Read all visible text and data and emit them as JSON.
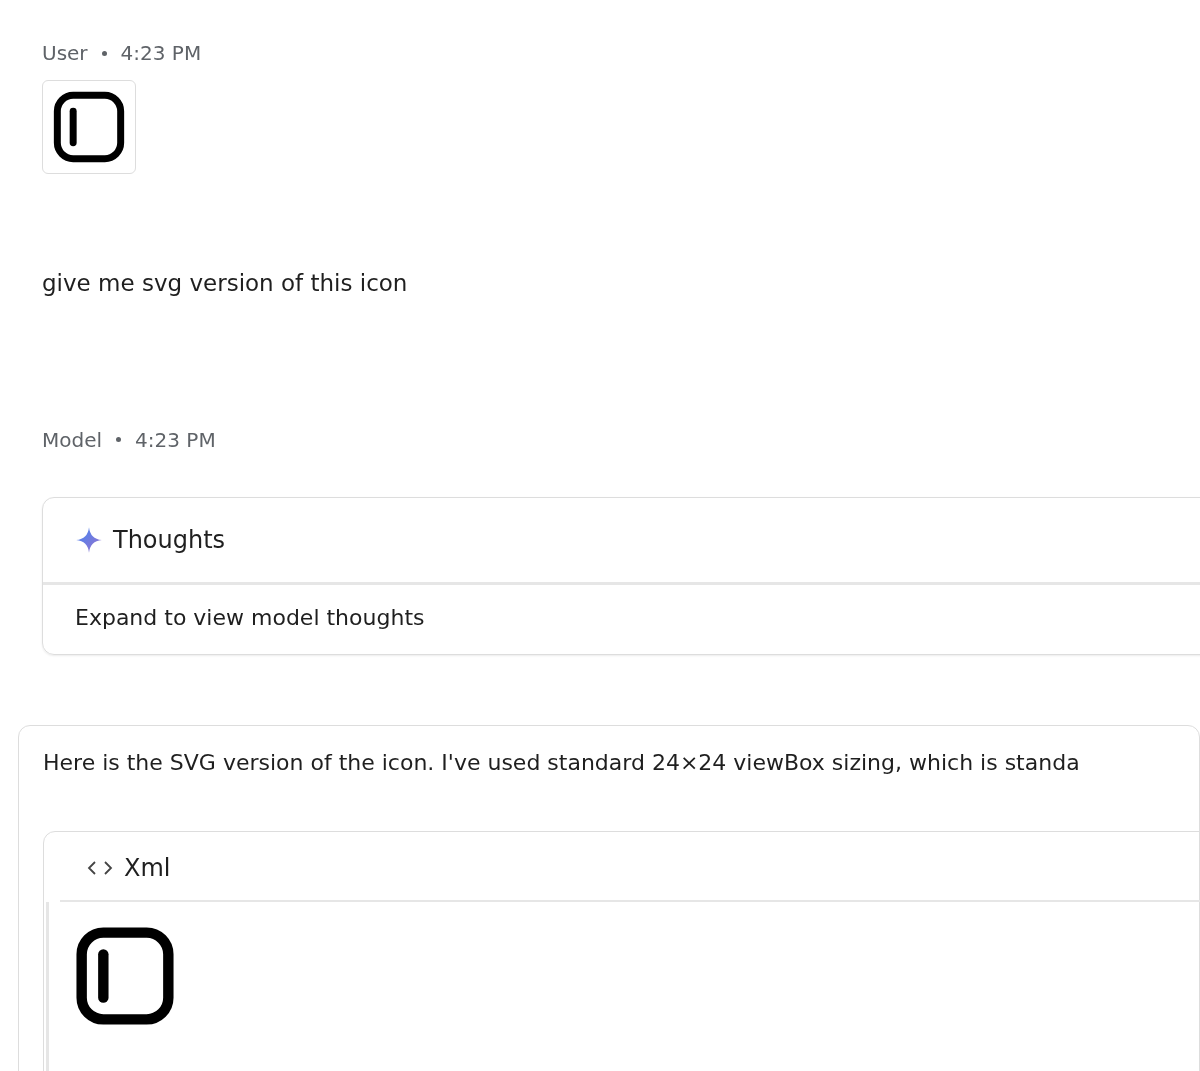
{
  "messages": [
    {
      "kind": "user",
      "sender": "User",
      "time": "4:23 PM",
      "attachment": {
        "kind": "icon-image"
      },
      "text": "give me svg version of this icon"
    },
    {
      "kind": "model",
      "sender": "Model",
      "time": "4:23 PM",
      "thoughts": {
        "title": "Thoughts",
        "summary": "Expand to view model thoughts"
      },
      "text": "Here is the SVG version of the icon. I've used standard 24×24 viewBox sizing, which is standa",
      "code": {
        "language": "Xml",
        "preview": {
          "kind": "icon"
        }
      }
    }
  ]
}
